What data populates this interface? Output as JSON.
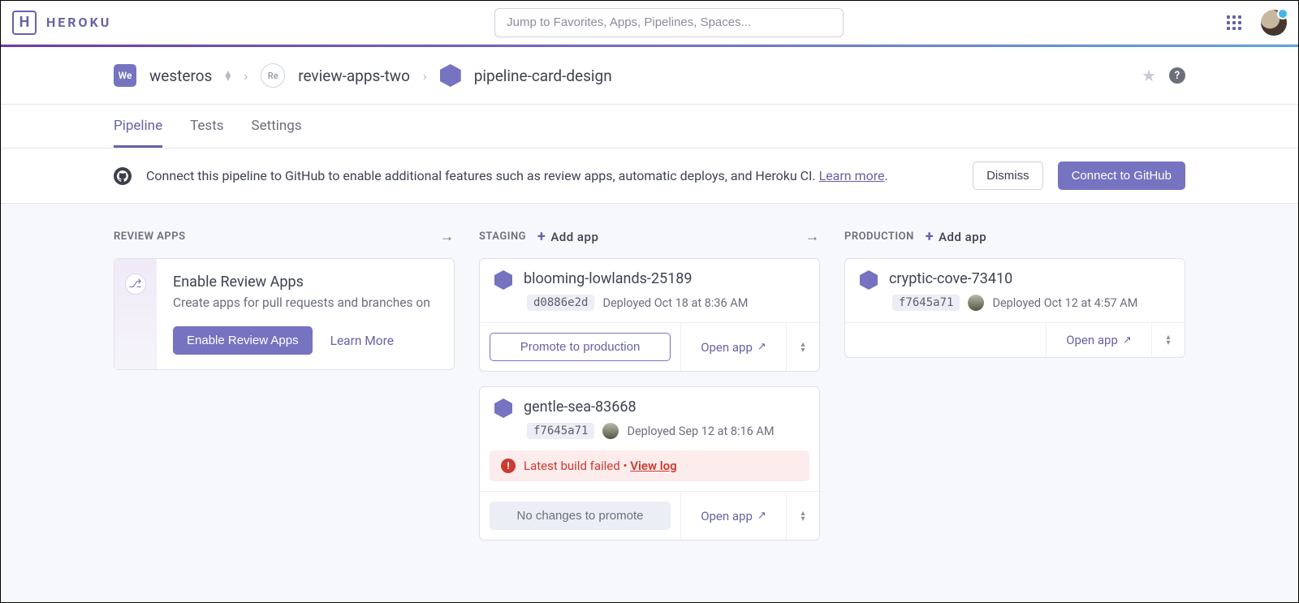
{
  "brand": "HEROKU",
  "search": {
    "placeholder": "Jump to Favorites, Apps, Pipelines, Spaces..."
  },
  "breadcrumbs": {
    "team_chip": "We",
    "team": "westeros",
    "space_chip": "Re",
    "space": "review-apps-two",
    "pipeline": "pipeline-card-design"
  },
  "tabs": [
    "Pipeline",
    "Tests",
    "Settings"
  ],
  "active_tab": 0,
  "banner": {
    "text": "Connect this pipeline to GitHub to enable additional features such as review apps, automatic deploys, and Heroku CI. ",
    "learn_more": "Learn more",
    "dismiss": "Dismiss",
    "connect": "Connect to GitHub"
  },
  "columns": {
    "review": {
      "title": "Review Apps"
    },
    "staging": {
      "title": "Staging",
      "add_label": "Add app"
    },
    "production": {
      "title": "Production",
      "add_label": "Add app"
    }
  },
  "review_promo": {
    "title": "Enable Review Apps",
    "desc": "Create apps for pull requests and branches on",
    "enable": "Enable Review Apps",
    "learn_more": "Learn More"
  },
  "staging_apps": [
    {
      "name": "blooming-lowlands-25189",
      "sha": "d0886e2d",
      "deployed": "Deployed Oct 18 at 8:36 AM",
      "promote": "Promote to production",
      "open": "Open app"
    },
    {
      "name": "gentle-sea-83668",
      "sha": "f7645a71",
      "deployed": "Deployed Sep 12 at 8:16 AM",
      "error": "Latest build failed",
      "error_link": "View log",
      "no_changes": "No changes to promote",
      "open": "Open app"
    }
  ],
  "production_apps": [
    {
      "name": "cryptic-cove-73410",
      "sha": "f7645a71",
      "deployed": "Deployed Oct 12 at 4:57 AM",
      "open": "Open app"
    }
  ]
}
